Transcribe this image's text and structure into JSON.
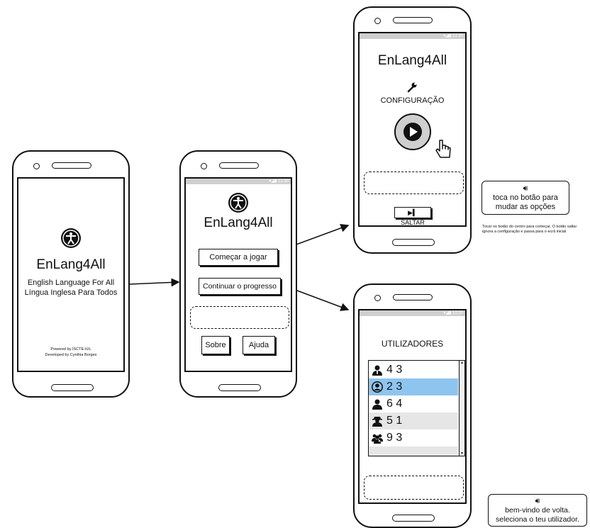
{
  "splash": {
    "app_title": "EnLang4All",
    "tagline_en": "English Language For All",
    "tagline_pt": "Língua Inglesa Para Todos",
    "powered_by": "Powered by ISCTE-IUL",
    "developed_by": "Developed by Cynthia Borges"
  },
  "menu": {
    "app_title": "EnLang4All",
    "start_button": "Começar a jogar",
    "continue_button": "Continuar o progresso",
    "about_button": "Sobre",
    "help_button": "Ajuda"
  },
  "config": {
    "app_title": "EnLang4All",
    "config_label": "CONFIGURAÇÃO",
    "skip_button": "SALTAR",
    "note_audio": "toca no botão para mudar as opções",
    "note_small": "Tocar no botão do centro para começar, O botão saltar ignora a configuração e passa para o ecrã inicial"
  },
  "users": {
    "title": "UTILIZADORES",
    "rows": [
      {
        "icon": "user-tie-icon",
        "value": "4 3"
      },
      {
        "icon": "user-circle-icon",
        "value": "2 3"
      },
      {
        "icon": "user-icon",
        "value": "6 4"
      },
      {
        "icon": "user-secret-icon",
        "value": "5 1"
      },
      {
        "icon": "users-icon",
        "value": "9 3"
      }
    ],
    "selected_index": 1,
    "note_audio": "bem-vindo de volta. seleciona o teu utilizador."
  },
  "colors": {
    "selected_row": "#8ec5ee",
    "alt_row": "#e6e6e6",
    "status_bar": "#cfcfcf"
  }
}
